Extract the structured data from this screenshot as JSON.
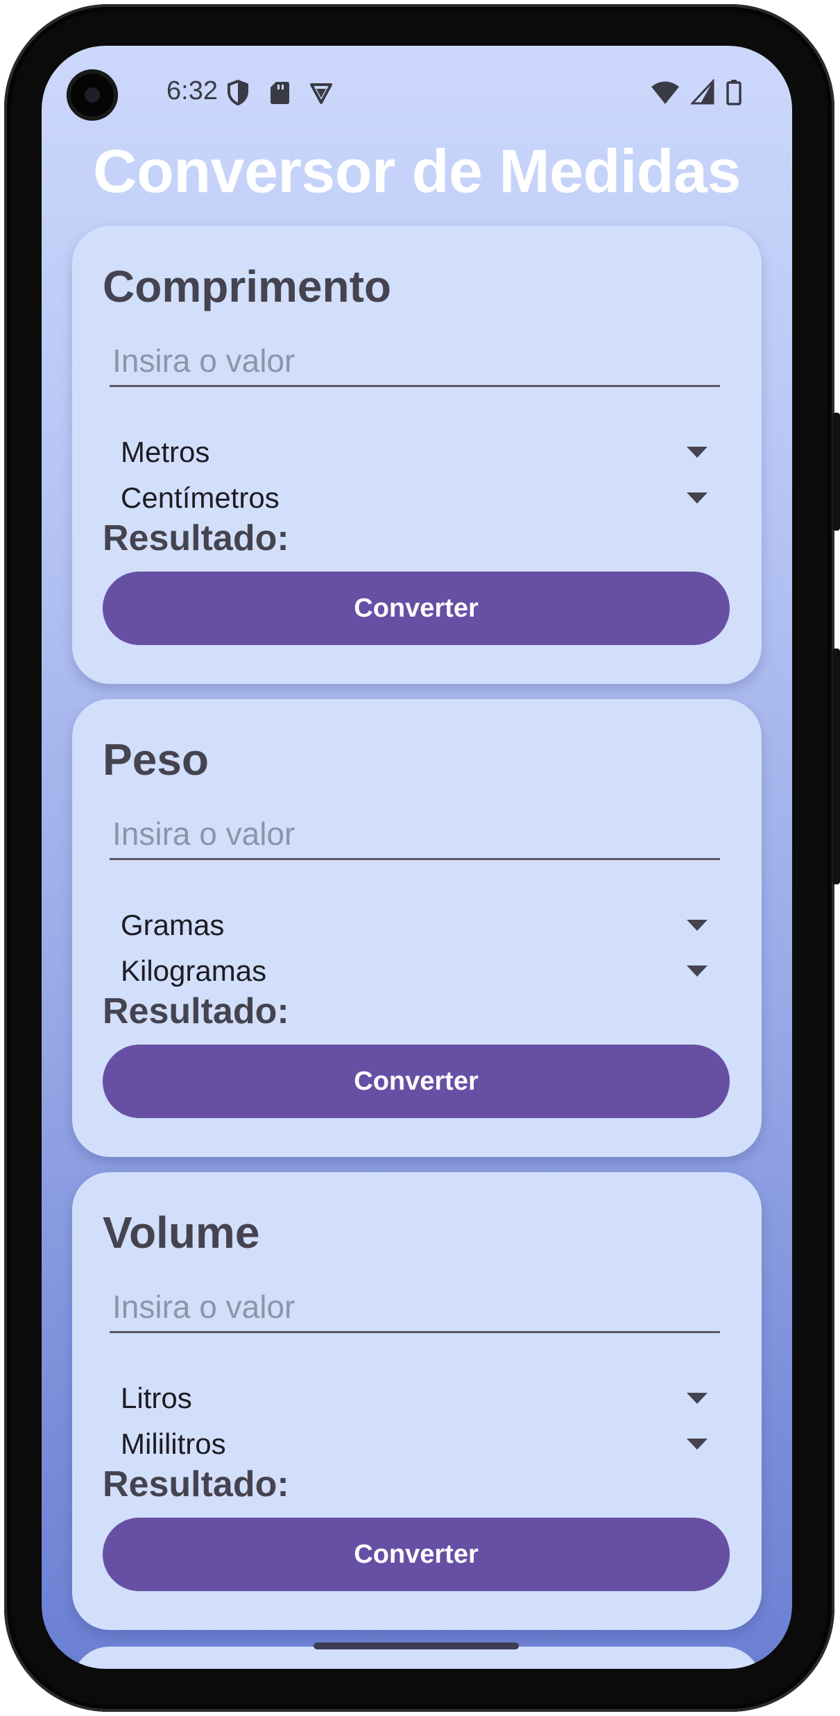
{
  "status_bar": {
    "time": "6:32",
    "left_icons": [
      "shield-icon",
      "sd-card-icon",
      "vpn-icon"
    ],
    "right_icons": [
      "wifi-icon",
      "signal-icon",
      "battery-icon"
    ]
  },
  "app": {
    "title": "Conversor de Medidas"
  },
  "cards": [
    {
      "title": "Comprimento",
      "input_placeholder": "Insira o valor",
      "input_value": "",
      "from_unit": "Metros",
      "to_unit": "Centímetros",
      "result_label": "Resultado:",
      "button_label": "Converter"
    },
    {
      "title": "Peso",
      "input_placeholder": "Insira o valor",
      "input_value": "",
      "from_unit": "Gramas",
      "to_unit": "Kilogramas",
      "result_label": "Resultado:",
      "button_label": "Converter"
    },
    {
      "title": "Volume",
      "input_placeholder": "Insira o valor",
      "input_value": "",
      "from_unit": "Litros",
      "to_unit": "Mililitros",
      "result_label": "Resultado:",
      "button_label": "Converter"
    }
  ],
  "colors": {
    "accent": "#6750a4",
    "card_background": "#d2dffb",
    "title_text": "#ffffff",
    "card_text": "#45434f"
  }
}
